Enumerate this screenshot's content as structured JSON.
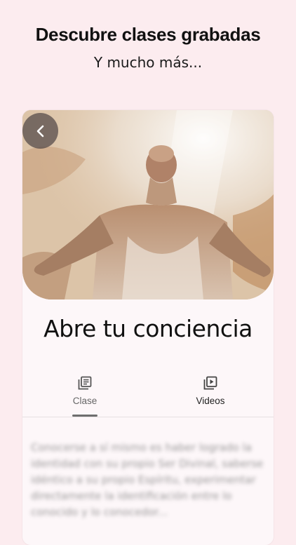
{
  "promo": {
    "title": "Descubre clases grabadas",
    "subtitle": "Y mucho más..."
  },
  "screen": {
    "class_title": "Abre tu conciencia",
    "tabs": [
      {
        "label": "Clase",
        "icon": "library-books-icon",
        "selected": true
      },
      {
        "label": "Videos",
        "icon": "video-library-icon",
        "selected": false
      }
    ],
    "description": "Conocerse a sí mismo es haber logrado la identidad con su propio Ser Divinal, saberse idéntico a su propio Espíritu, experimentar directamente la identificación entre lo conocido y lo conocedor..."
  },
  "colors": {
    "page_background": "#fcecef",
    "card_background": "#fdf7f9",
    "back_button_background": "#504646"
  }
}
